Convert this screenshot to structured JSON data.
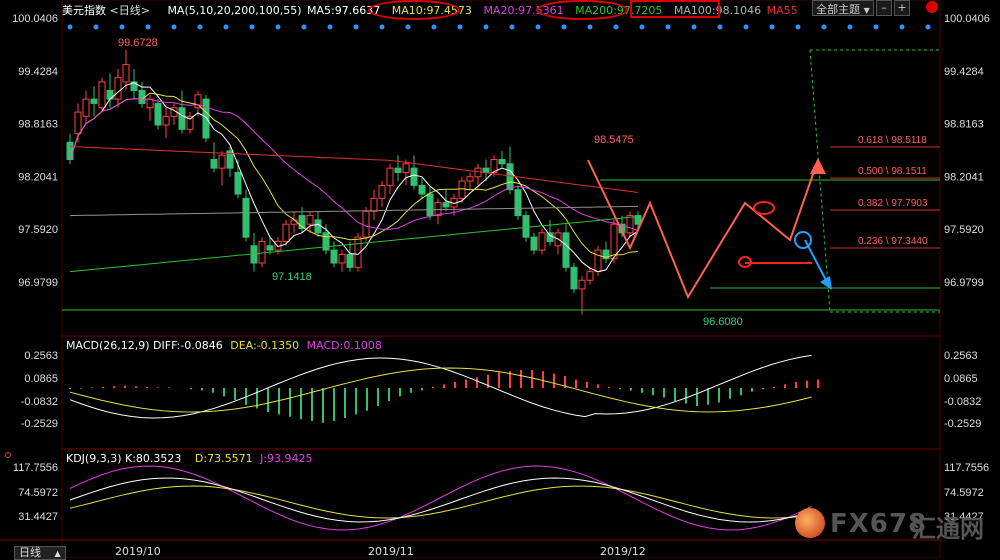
{
  "header": {
    "instrument": "美元指数",
    "period": "<日线>",
    "ma_params": "MA(5,10,20,200,100,55)",
    "ma5": "MA5:97.6637",
    "ma10": "MA10:97.4573",
    "ma20": "MA20:97.5361",
    "ma200": "MA200:97.7205",
    "ma100": "MA100:98.1046",
    "ma55": "MA55",
    "theme_button": "全部主题",
    "theme_arrow": "▼"
  },
  "macd_header": {
    "params": "MACD(26,12,9)",
    "diff": "DIFF:-0.0846",
    "dea": "DEA:-0.1350",
    "macd": "MACD:0.1008"
  },
  "kdj_header": {
    "params": "KDJ(9,3,3)",
    "k": "K:80.3523",
    "d": "D:73.5571",
    "j": "J:93.9425"
  },
  "price_axis": [
    "100.0406",
    "99.4284",
    "98.8163",
    "98.2041",
    "97.5920",
    "96.9799"
  ],
  "macd_axis": [
    "0.2563",
    "0.0865",
    "-0.0832",
    "-0.2529"
  ],
  "kdj_axis": [
    "117.7556",
    "74.5972",
    "31.4427"
  ],
  "date_labels": [
    "2019/10",
    "2019/11",
    "2019/12"
  ],
  "bottom_tab": "日线",
  "bottom_tab_icon": "▲",
  "annotations": {
    "high1": "99.6728",
    "low1": "97.1418",
    "high2": "98.5475",
    "low2": "96.6080",
    "fib": [
      "0.618 \\ 98.5118",
      "0.500 \\ 98.1511",
      "0.382 \\ 97.7903",
      "0.236 \\ 97.3440"
    ]
  },
  "watermark": {
    "brand": "FX678",
    "cn": "汇通网"
  },
  "colors": {
    "bg": "#000000",
    "up": "#ff4040",
    "down": "#30c070",
    "ma5": "#ffffff",
    "ma10": "#e8e040",
    "ma20": "#e040e0",
    "ma55": "#e03030",
    "ma100": "#909090",
    "ma200": "#30c030",
    "arrow": "#ff6050",
    "blue": "#20a0ff"
  },
  "chart_data": {
    "type": "candlestick",
    "title": "美元指数 <日线>",
    "y_range": [
      96.5,
      100.1
    ],
    "ticks": [
      100.0406,
      99.4284,
      98.8163,
      98.2041,
      97.592,
      96.9799
    ],
    "candles": [
      [
        98.6,
        98.7,
        98.35,
        98.4
      ],
      [
        98.7,
        99.05,
        98.6,
        98.95
      ],
      [
        98.9,
        99.2,
        98.8,
        99.1
      ],
      [
        99.1,
        99.25,
        98.9,
        99.05
      ],
      [
        99.0,
        99.35,
        98.95,
        99.3
      ],
      [
        99.2,
        99.4,
        99.0,
        99.1
      ],
      [
        99.1,
        99.45,
        99.0,
        99.35
      ],
      [
        99.3,
        99.67,
        99.2,
        99.5
      ],
      [
        99.3,
        99.45,
        99.1,
        99.2
      ],
      [
        99.2,
        99.3,
        99.0,
        99.05
      ],
      [
        99.0,
        99.15,
        98.85,
        99.1
      ],
      [
        99.05,
        99.1,
        98.75,
        98.8
      ],
      [
        98.8,
        99.0,
        98.65,
        98.9
      ],
      [
        98.9,
        99.05,
        98.8,
        99.0
      ],
      [
        99.0,
        99.2,
        98.7,
        98.75
      ],
      [
        98.75,
        98.95,
        98.7,
        98.9
      ],
      [
        99.0,
        99.2,
        98.9,
        99.15
      ],
      [
        99.1,
        99.15,
        98.6,
        98.65
      ],
      [
        98.4,
        98.6,
        98.25,
        98.3
      ],
      [
        98.3,
        98.5,
        98.1,
        98.45
      ],
      [
        98.5,
        98.55,
        98.2,
        98.3
      ],
      [
        98.25,
        98.4,
        97.95,
        98.0
      ],
      [
        97.95,
        98.05,
        97.45,
        97.5
      ],
      [
        97.4,
        97.55,
        97.1,
        97.2
      ],
      [
        97.2,
        97.5,
        97.15,
        97.45
      ],
      [
        97.4,
        97.5,
        97.3,
        97.35
      ],
      [
        97.35,
        97.5,
        97.3,
        97.45
      ],
      [
        97.45,
        97.7,
        97.4,
        97.65
      ],
      [
        97.65,
        97.8,
        97.55,
        97.7
      ],
      [
        97.75,
        97.85,
        97.55,
        97.6
      ],
      [
        97.65,
        97.8,
        97.55,
        97.75
      ],
      [
        97.7,
        97.8,
        97.5,
        97.55
      ],
      [
        97.55,
        97.65,
        97.3,
        97.35
      ],
      [
        97.35,
        97.45,
        97.15,
        97.2
      ],
      [
        97.2,
        97.35,
        97.1,
        97.3
      ],
      [
        97.3,
        97.45,
        97.1,
        97.15
      ],
      [
        97.15,
        97.55,
        97.1,
        97.5
      ],
      [
        97.5,
        97.85,
        97.45,
        97.8
      ],
      [
        97.8,
        98.05,
        97.7,
        97.95
      ],
      [
        97.95,
        98.15,
        97.85,
        98.1
      ],
      [
        98.1,
        98.35,
        98.0,
        98.3
      ],
      [
        98.3,
        98.45,
        98.15,
        98.25
      ],
      [
        98.25,
        98.4,
        98.1,
        98.35
      ],
      [
        98.3,
        98.45,
        98.05,
        98.1
      ],
      [
        98.1,
        98.2,
        97.95,
        98.0
      ],
      [
        98.0,
        98.1,
        97.7,
        97.75
      ],
      [
        97.75,
        97.95,
        97.65,
        97.9
      ],
      [
        97.9,
        98.05,
        97.8,
        97.85
      ],
      [
        97.85,
        98.0,
        97.75,
        97.95
      ],
      [
        97.95,
        98.2,
        97.9,
        98.15
      ],
      [
        98.15,
        98.25,
        98.05,
        98.2
      ],
      [
        98.2,
        98.35,
        98.1,
        98.3
      ],
      [
        98.3,
        98.4,
        98.15,
        98.25
      ],
      [
        98.25,
        98.45,
        98.2,
        98.4
      ],
      [
        98.4,
        98.5,
        98.3,
        98.35
      ],
      [
        98.35,
        98.55,
        98.0,
        98.05
      ],
      [
        98.05,
        98.1,
        97.7,
        97.75
      ],
      [
        97.75,
        97.8,
        97.45,
        97.5
      ],
      [
        97.5,
        97.55,
        97.3,
        97.35
      ],
      [
        97.35,
        97.6,
        97.3,
        97.55
      ],
      [
        97.55,
        97.7,
        97.4,
        97.45
      ],
      [
        97.4,
        97.6,
        97.3,
        97.55
      ],
      [
        97.55,
        97.65,
        97.1,
        97.15
      ],
      [
        97.15,
        97.2,
        96.85,
        96.9
      ],
      [
        96.9,
        97.05,
        96.6,
        97.0
      ],
      [
        97.0,
        97.15,
        96.95,
        97.1
      ],
      [
        97.1,
        97.4,
        97.05,
        97.35
      ],
      [
        97.35,
        97.45,
        97.2,
        97.25
      ],
      [
        97.25,
        97.7,
        97.2,
        97.65
      ],
      [
        97.65,
        97.75,
        97.5,
        97.55
      ],
      [
        97.55,
        97.8,
        97.5,
        97.75
      ],
      [
        97.75,
        97.8,
        97.6,
        97.65
      ]
    ]
  }
}
